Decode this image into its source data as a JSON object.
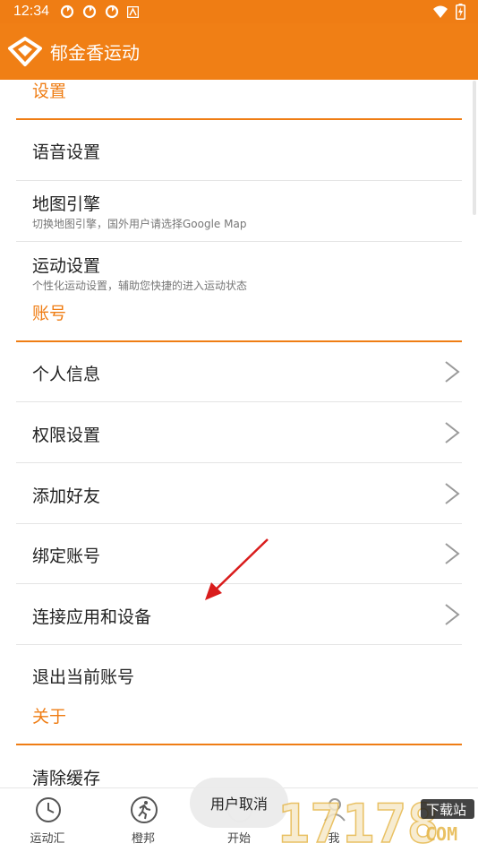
{
  "status_bar": {
    "time": "12:34"
  },
  "app": {
    "title": "郁金香运动"
  },
  "sections": {
    "settings": "设置",
    "account": "账号",
    "about": "关于"
  },
  "settings_items": {
    "voice": "语音设置",
    "map_engine": "地图引擎",
    "map_engine_sub": "切换地图引擎，国外用户请选择Google Map",
    "sport_settings": "运动设置",
    "sport_settings_sub": "个性化运动设置，辅助您快捷的进入运动状态"
  },
  "account_items": {
    "profile": "个人信息",
    "permissions": "权限设置",
    "add_friend": "添加好友",
    "bind_account": "绑定账号",
    "connect_apps": "连接应用和设备",
    "logout": "退出当前账号"
  },
  "about_items": {
    "clear_cache": "清除缓存"
  },
  "toast": "用户取消",
  "bottom_nav": {
    "tab1": "运动汇",
    "tab2": "橙邦",
    "tab3": "开始",
    "tab4": "我"
  },
  "watermark": {
    "text": "17178",
    "sub": "下载站",
    "domain": "COM"
  },
  "colors": {
    "accent": "#F07F15",
    "divider": "#E4E4E4"
  }
}
